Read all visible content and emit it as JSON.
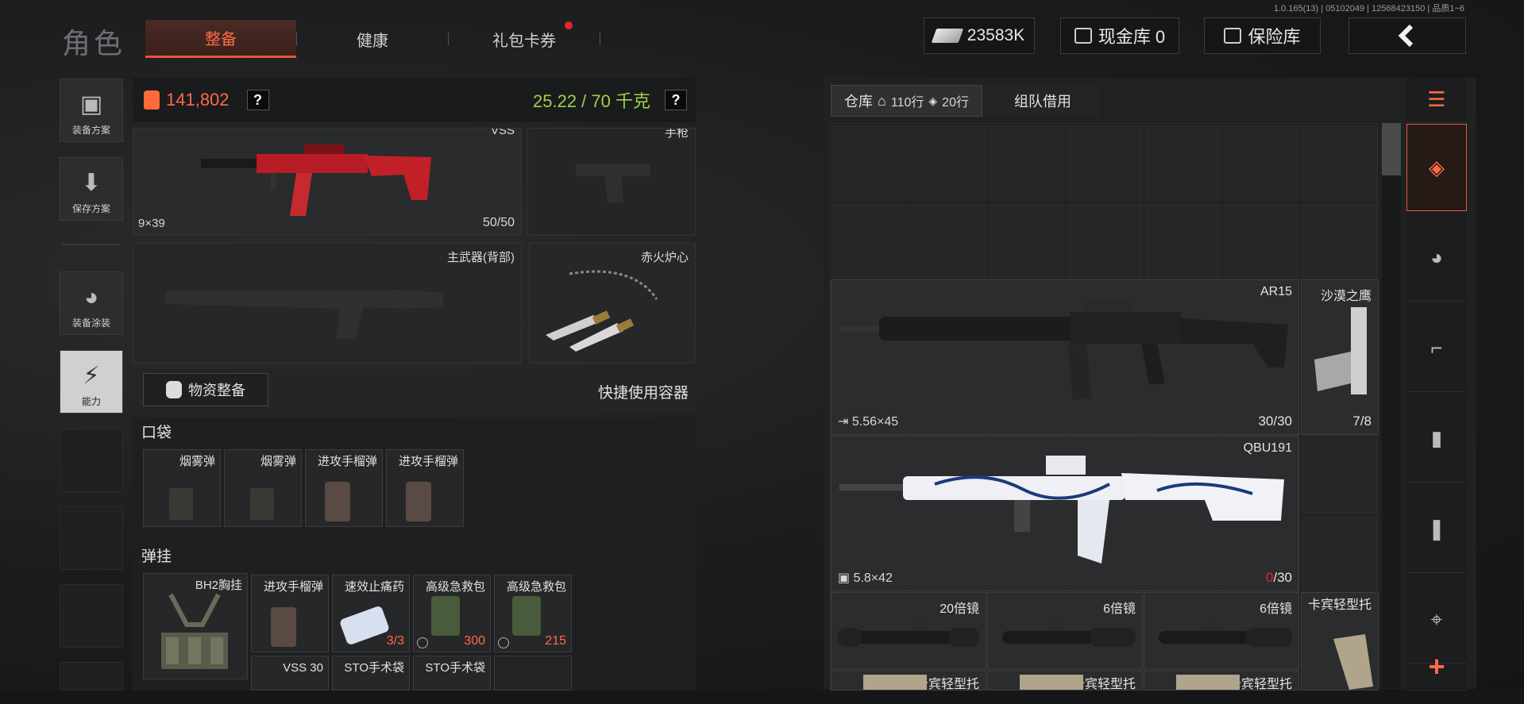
{
  "version": "1.0.165(13) | 05102049 | 12568423150 | 品质1~6",
  "header": {
    "title": "角色",
    "tabs": [
      {
        "label": "整备"
      },
      {
        "label": "健康"
      },
      {
        "label": "礼包卡券"
      }
    ],
    "money": "23583K",
    "cash_vault": "现金库 0",
    "safe": "保险库"
  },
  "left_sidebar": [
    {
      "label": "装备方案",
      "icon": "vest-icon"
    },
    {
      "label": "保存方案",
      "icon": "download-icon"
    },
    {
      "label": "装备涂装",
      "icon": "helmet-icon"
    },
    {
      "label": "能力",
      "icon": "lightning-icon"
    }
  ],
  "stats": {
    "value": "141,802",
    "weight": "25.22 / 70 千克",
    "help": "?"
  },
  "loadout": {
    "main_weapon": {
      "label": "VSS",
      "caliber": "9×39",
      "ammo": "50/50"
    },
    "pistol": {
      "label": "手枪"
    },
    "back_weapon": {
      "label": "主武器(背部)"
    },
    "melee": {
      "label": "赤火炉心"
    }
  },
  "supply": {
    "button": "物资整备",
    "quick": "快捷使用容器"
  },
  "pocket": {
    "title": "口袋",
    "items": [
      "烟雾弹",
      "烟雾弹",
      "进攻手榴弹",
      "进攻手榴弹"
    ]
  },
  "rig": {
    "title": "弹挂",
    "rig_name": "BH2胸挂",
    "items": [
      {
        "name": "进攻手榴弹",
        "count": ""
      },
      {
        "name": "速效止痛药",
        "count": "3/3"
      },
      {
        "name": "高级急救包",
        "count": "300"
      },
      {
        "name": "高级急救包",
        "count": "215"
      },
      {
        "name": "VSS 30",
        "count": ""
      },
      {
        "name": "STO手术袋",
        "count": ""
      },
      {
        "name": "STO手术袋",
        "count": ""
      }
    ]
  },
  "warehouse": {
    "tabs": [
      {
        "label": "仓库",
        "rows1": "110行",
        "rows2": "20行"
      },
      {
        "label": "组队借用"
      }
    ],
    "items": [
      {
        "name": "AR15",
        "caliber": "5.56×45",
        "ammo": "30/30"
      },
      {
        "name": "沙漠之鹰",
        "caliber": "",
        "ammo": "7/8"
      },
      {
        "name": "QBU191",
        "caliber": "5.8×42",
        "ammo_cur": "0",
        "ammo_max": "/30"
      },
      {
        "name": "20倍镜"
      },
      {
        "name": "6倍镜"
      },
      {
        "name": "6倍镜"
      },
      {
        "name": "卡宾轻型托"
      },
      {
        "name": "卡宾轻型托"
      },
      {
        "name": "卡宾轻型托"
      },
      {
        "name": "卡宾轻型托"
      }
    ]
  },
  "filters": [
    {
      "icon": "stack-refresh-icon"
    },
    {
      "icon": "all-items-icon"
    },
    {
      "icon": "helmet-icon"
    },
    {
      "icon": "rifle-icon"
    },
    {
      "icon": "magazine-icon"
    },
    {
      "icon": "ammo-icon"
    },
    {
      "icon": "scope-icon"
    },
    {
      "icon": "plus-icon"
    }
  ],
  "colors": {
    "accent": "#e8553a",
    "weight": "#9ad24a"
  }
}
